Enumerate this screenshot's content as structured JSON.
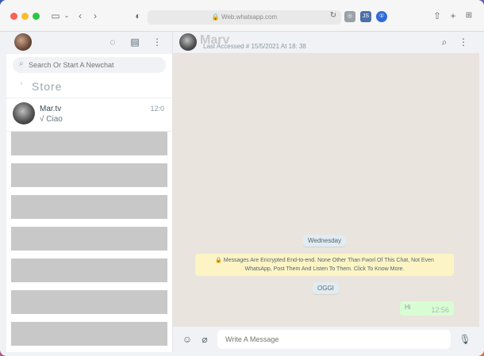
{
  "browser": {
    "url": "Web.whatsapp.com",
    "icons": {
      "sidebar": "sidebar-icon",
      "back": "chevron-left-icon",
      "forward": "chevron-right-icon",
      "shield": "shield-icon",
      "reload": "reload-icon",
      "share": "share-icon",
      "new_tab": "plus-icon",
      "tabs": "grid-icon"
    },
    "ext_js": "JS"
  },
  "sidebar": {
    "search_placeholder": "Search Or Start A Newchat",
    "store_label": "Store",
    "chats": [
      {
        "name": "Mar.tv",
        "time": "12:0",
        "last_message": "√ Ciao"
      }
    ],
    "placeholder_rows": 7
  },
  "chat": {
    "contact_name": "Marv",
    "status": "Last Accessed # 15/5/2021 At 18: 38",
    "date_pill_1": "Wednesday",
    "encryption_line_1": "Messages Are Encrypted End-to-end. None Other Than Fworl Of This Chat, Not Even",
    "encryption_line_2": "WhatsApp, Post Them And Listen To Them. Click To Know More.",
    "date_pill_2": "OGGI",
    "outgoing": {
      "text": "Hi",
      "time": "12:56"
    },
    "composer_placeholder": "Write A Message"
  },
  "colors": {
    "chat_bg": "#e9e4dd",
    "encrypt_bg": "#fdf4c5",
    "out_bubble": "#d9fdd3",
    "header_bg": "#f0f2f5"
  }
}
